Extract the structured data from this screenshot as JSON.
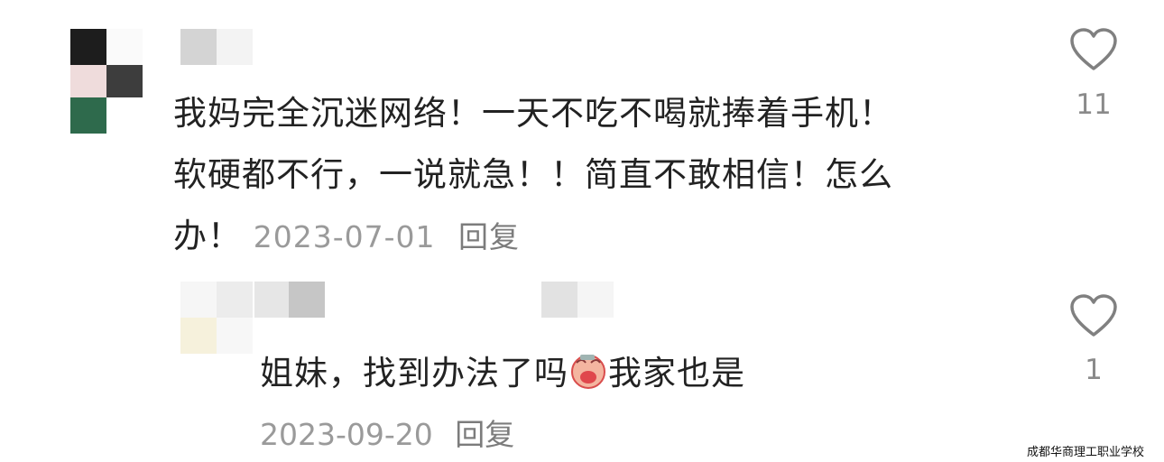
{
  "comment": {
    "lines": [
      "我妈完全沉迷网络！一天不吃不喝就捧着手机！",
      "软硬都不行，一说就急！！简直不敢相信！怎么",
      "办！"
    ],
    "date": "2023-07-01",
    "reply_label": "回复",
    "like_count": "11"
  },
  "reply": {
    "text_before_emoji": "姐妹，找到办法了吗",
    "emoji": "crying-face",
    "text_after_emoji": "我家也是",
    "date": "2023-09-20",
    "reply_label": "回复",
    "like_count": "1"
  },
  "watermark": "成都华商理工职业学校",
  "colors": {
    "text": "#222222",
    "meta": "#9a9a9a",
    "icon": "#808080"
  }
}
